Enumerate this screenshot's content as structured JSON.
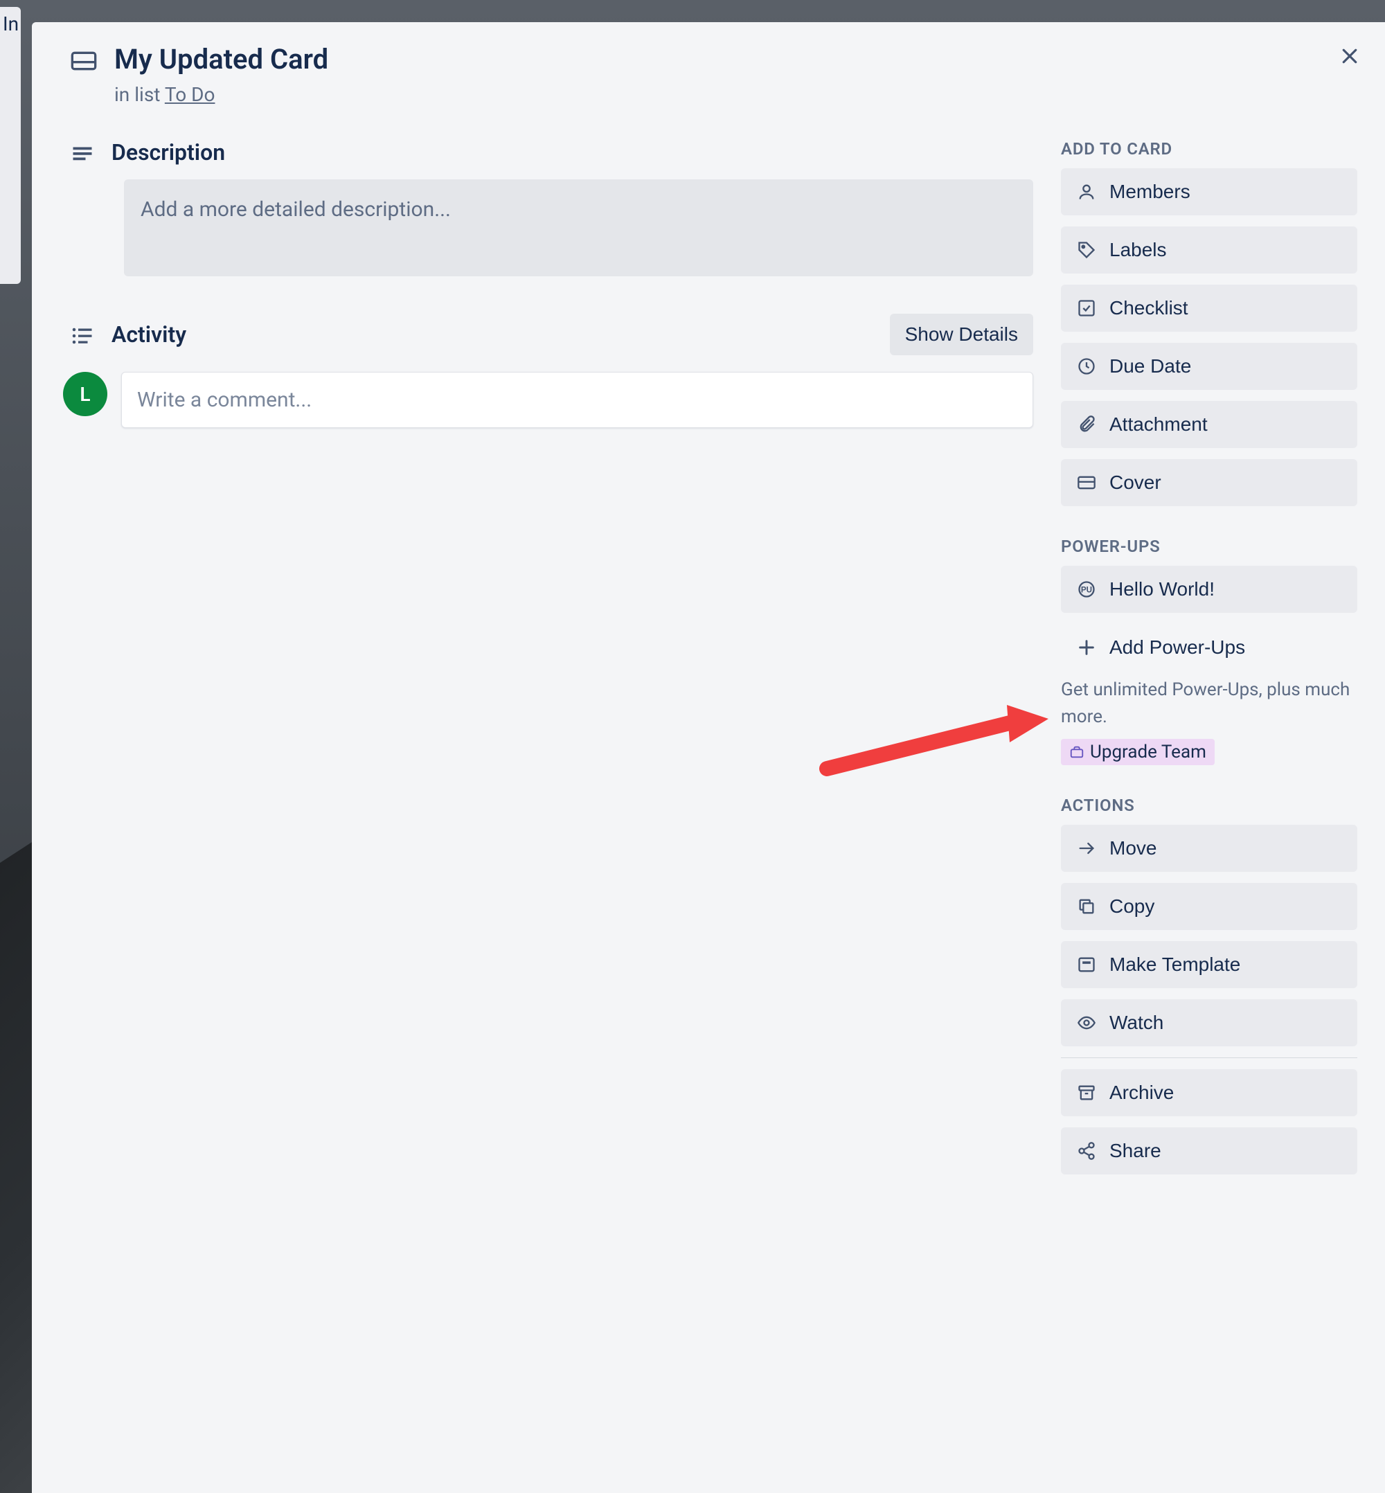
{
  "bg_list_hint": "In",
  "card": {
    "title": "My Updated Card",
    "in_list_prefix": "in list ",
    "list_name": "To Do"
  },
  "description": {
    "heading": "Description",
    "placeholder": "Add a more detailed description..."
  },
  "activity": {
    "heading": "Activity",
    "show_details": "Show Details",
    "comment_placeholder": "Write a comment...",
    "avatar_initial": "L"
  },
  "sidebar": {
    "add_to_card": {
      "heading": "ADD TO CARD",
      "members": "Members",
      "labels": "Labels",
      "checklist": "Checklist",
      "due_date": "Due Date",
      "attachment": "Attachment",
      "cover": "Cover"
    },
    "power_ups": {
      "heading": "POWER-UPS",
      "hello_world": "Hello World!",
      "add": "Add Power-Ups",
      "hint": "Get unlimited Power-Ups, plus much more.",
      "upgrade": "Upgrade Team"
    },
    "actions": {
      "heading": "ACTIONS",
      "move": "Move",
      "copy": "Copy",
      "make_template": "Make Template",
      "watch": "Watch",
      "archive": "Archive",
      "share": "Share"
    }
  }
}
